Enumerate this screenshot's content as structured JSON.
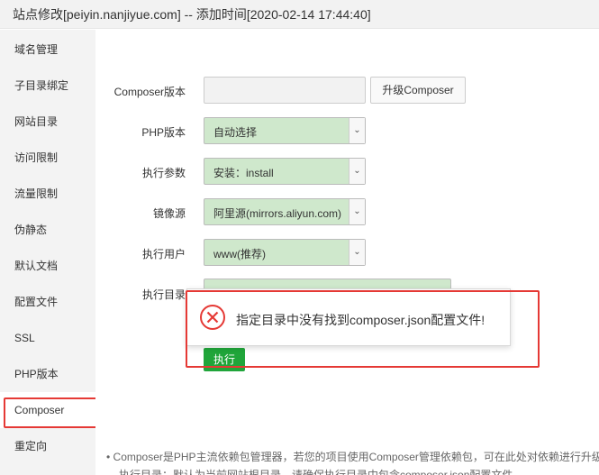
{
  "window": {
    "title": "站点修改[peiyin.nanjiyue.com] -- 添加时间[2020-02-14 17:44:40]"
  },
  "sidebar": {
    "items": [
      {
        "label": "域名管理"
      },
      {
        "label": "子目录绑定"
      },
      {
        "label": "网站目录"
      },
      {
        "label": "访问限制"
      },
      {
        "label": "流量限制"
      },
      {
        "label": "伪静态"
      },
      {
        "label": "默认文档"
      },
      {
        "label": "配置文件"
      },
      {
        "label": "SSL"
      },
      {
        "label": "PHP版本"
      },
      {
        "label": "Composer"
      },
      {
        "label": "重定向"
      }
    ],
    "active_item": "Composer"
  },
  "form": {
    "composer_version_label": "Composer版本",
    "composer_version_value": "",
    "upgrade_button": "升级Composer",
    "php_version_label": "PHP版本",
    "php_version_value": "自动选择",
    "exec_params_label": "执行参数",
    "exec_params_value": "安装：install",
    "mirror_label": "镜像源",
    "mirror_value": "阿里源(mirrors.aliyun.com)",
    "exec_user_label": "执行用户",
    "exec_user_value": "www(推荐)",
    "exec_dir_label": "执行目录",
    "exec_button": "执行"
  },
  "dialog": {
    "message": "指定目录中没有找到composer.json配置文件!",
    "icon": "error-circle-icon"
  },
  "notes": {
    "line1": "• Composer是PHP主流依赖包管理器，若您的项目使用Composer管理依赖包，可在此处对依赖进行升级或安装",
    "line2": "执行目录：默认为当前网站根目录，请确保执行目录中包含composer.json配置文件"
  },
  "colors": {
    "accent_green": "#20a53a",
    "select_green": "#cfe8cc",
    "error_red": "#e53935"
  }
}
